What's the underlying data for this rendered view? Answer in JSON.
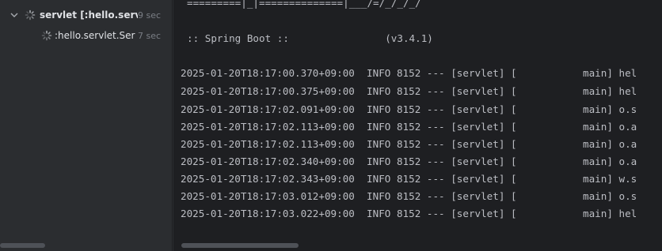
{
  "run_tree": {
    "root": {
      "label": "servlet [:hello.servlet.",
      "time": "9 sec"
    },
    "child": {
      "label": ":hello.servlet.Servle",
      "time": "7 sec"
    }
  },
  "console": {
    "banner_line": "=========|_|==============|___/=/_/_/_/",
    "boot_line": ":: Spring Boot ::                (v3.4.1)",
    "log_lines": [
      "2025-01-20T18:17:00.370+09:00  INFO 8152 --- [servlet] [           main] hel",
      "2025-01-20T18:17:00.375+09:00  INFO 8152 --- [servlet] [           main] hel",
      "2025-01-20T18:17:02.091+09:00  INFO 8152 --- [servlet] [           main] o.s",
      "2025-01-20T18:17:02.113+09:00  INFO 8152 --- [servlet] [           main] o.a",
      "2025-01-20T18:17:02.113+09:00  INFO 8152 --- [servlet] [           main] o.a",
      "2025-01-20T18:17:02.340+09:00  INFO 8152 --- [servlet] [           main] o.a",
      "2025-01-20T18:17:02.343+09:00  INFO 8152 --- [servlet] [           main] w.s",
      "2025-01-20T18:17:03.012+09:00  INFO 8152 --- [servlet] [           main] o.s",
      "2025-01-20T18:17:03.022+09:00  INFO 8152 --- [servlet] [           main] hel"
    ]
  },
  "icons": {
    "chevron": "chevron-down-icon",
    "spinner": "loading-spinner-icon"
  },
  "colors": {
    "panel_bg": "#2b2d30",
    "console_bg": "#1e1f22",
    "console_text": "#bcbec4",
    "muted_text": "#7a7e85"
  }
}
